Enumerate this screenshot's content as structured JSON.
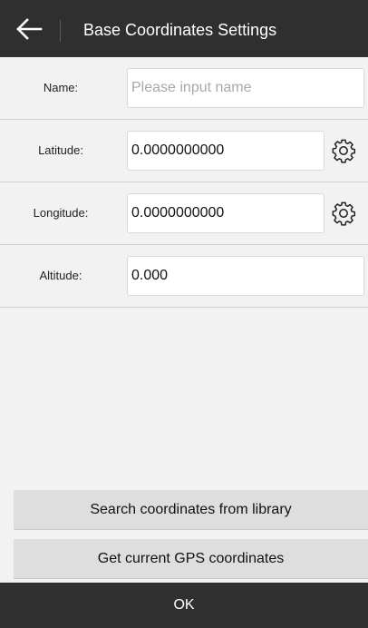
{
  "header": {
    "title": "Base Coordinates Settings",
    "back_icon": "arrow-left-icon"
  },
  "form": {
    "name": {
      "label": "Name:",
      "value": "",
      "placeholder": "Please input name"
    },
    "latitude": {
      "label": "Latitude:",
      "value": "0.0000000000",
      "icon": "gear-icon"
    },
    "longitude": {
      "label": "Longitude:",
      "value": "0.0000000000",
      "icon": "gear-icon"
    },
    "altitude": {
      "label": "Altitude:",
      "value": "0.000"
    }
  },
  "actions": {
    "search_library": "Search coordinates from library",
    "get_gps": "Get current GPS coordinates",
    "ok": "OK"
  },
  "colors": {
    "header_bg": "#2f2f2f",
    "page_bg": "#f2f2f2",
    "button_bg": "#dedede"
  }
}
